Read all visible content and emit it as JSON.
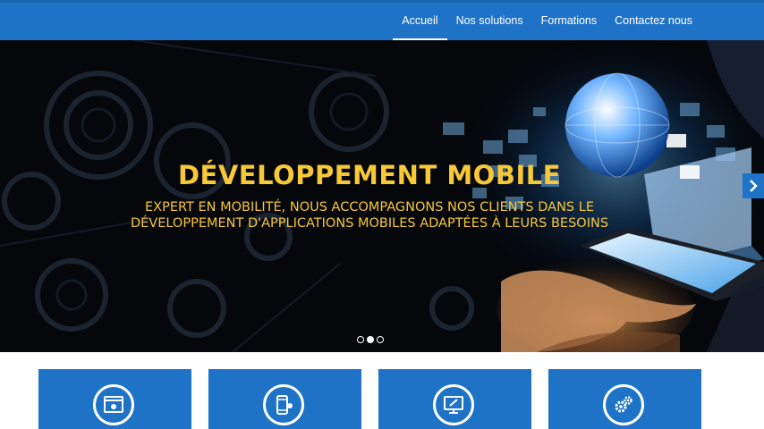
{
  "nav": {
    "items": [
      {
        "label": "Accueil",
        "active": true
      },
      {
        "label": "Nos solutions",
        "active": false
      },
      {
        "label": "Formations",
        "active": false
      },
      {
        "label": "Contactez nous",
        "active": false
      }
    ]
  },
  "hero": {
    "title": "DÉVELOPPEMENT MOBILE",
    "subtitle_line1": "EXPERT EN MOBILITÉ, NOUS ACCOMPAGNONS NOS CLIENTS DANS LE",
    "subtitle_line2": "DÉVELOPPEMENT D'APPLICATIONS MOBILES ADAPTÉES À LEURS BESOINS",
    "next_icon": "chevron-right-icon",
    "slides_total": 3,
    "slide_active": 2
  },
  "cards": [
    {
      "icon": "web-window-icon"
    },
    {
      "icon": "mobile-settings-icon"
    },
    {
      "icon": "monitor-design-icon"
    },
    {
      "icon": "gears-icon"
    }
  ],
  "colors": {
    "primary": "#1f73c6",
    "title_yellow": "#f7c838",
    "hero_bg": "#05070b"
  }
}
